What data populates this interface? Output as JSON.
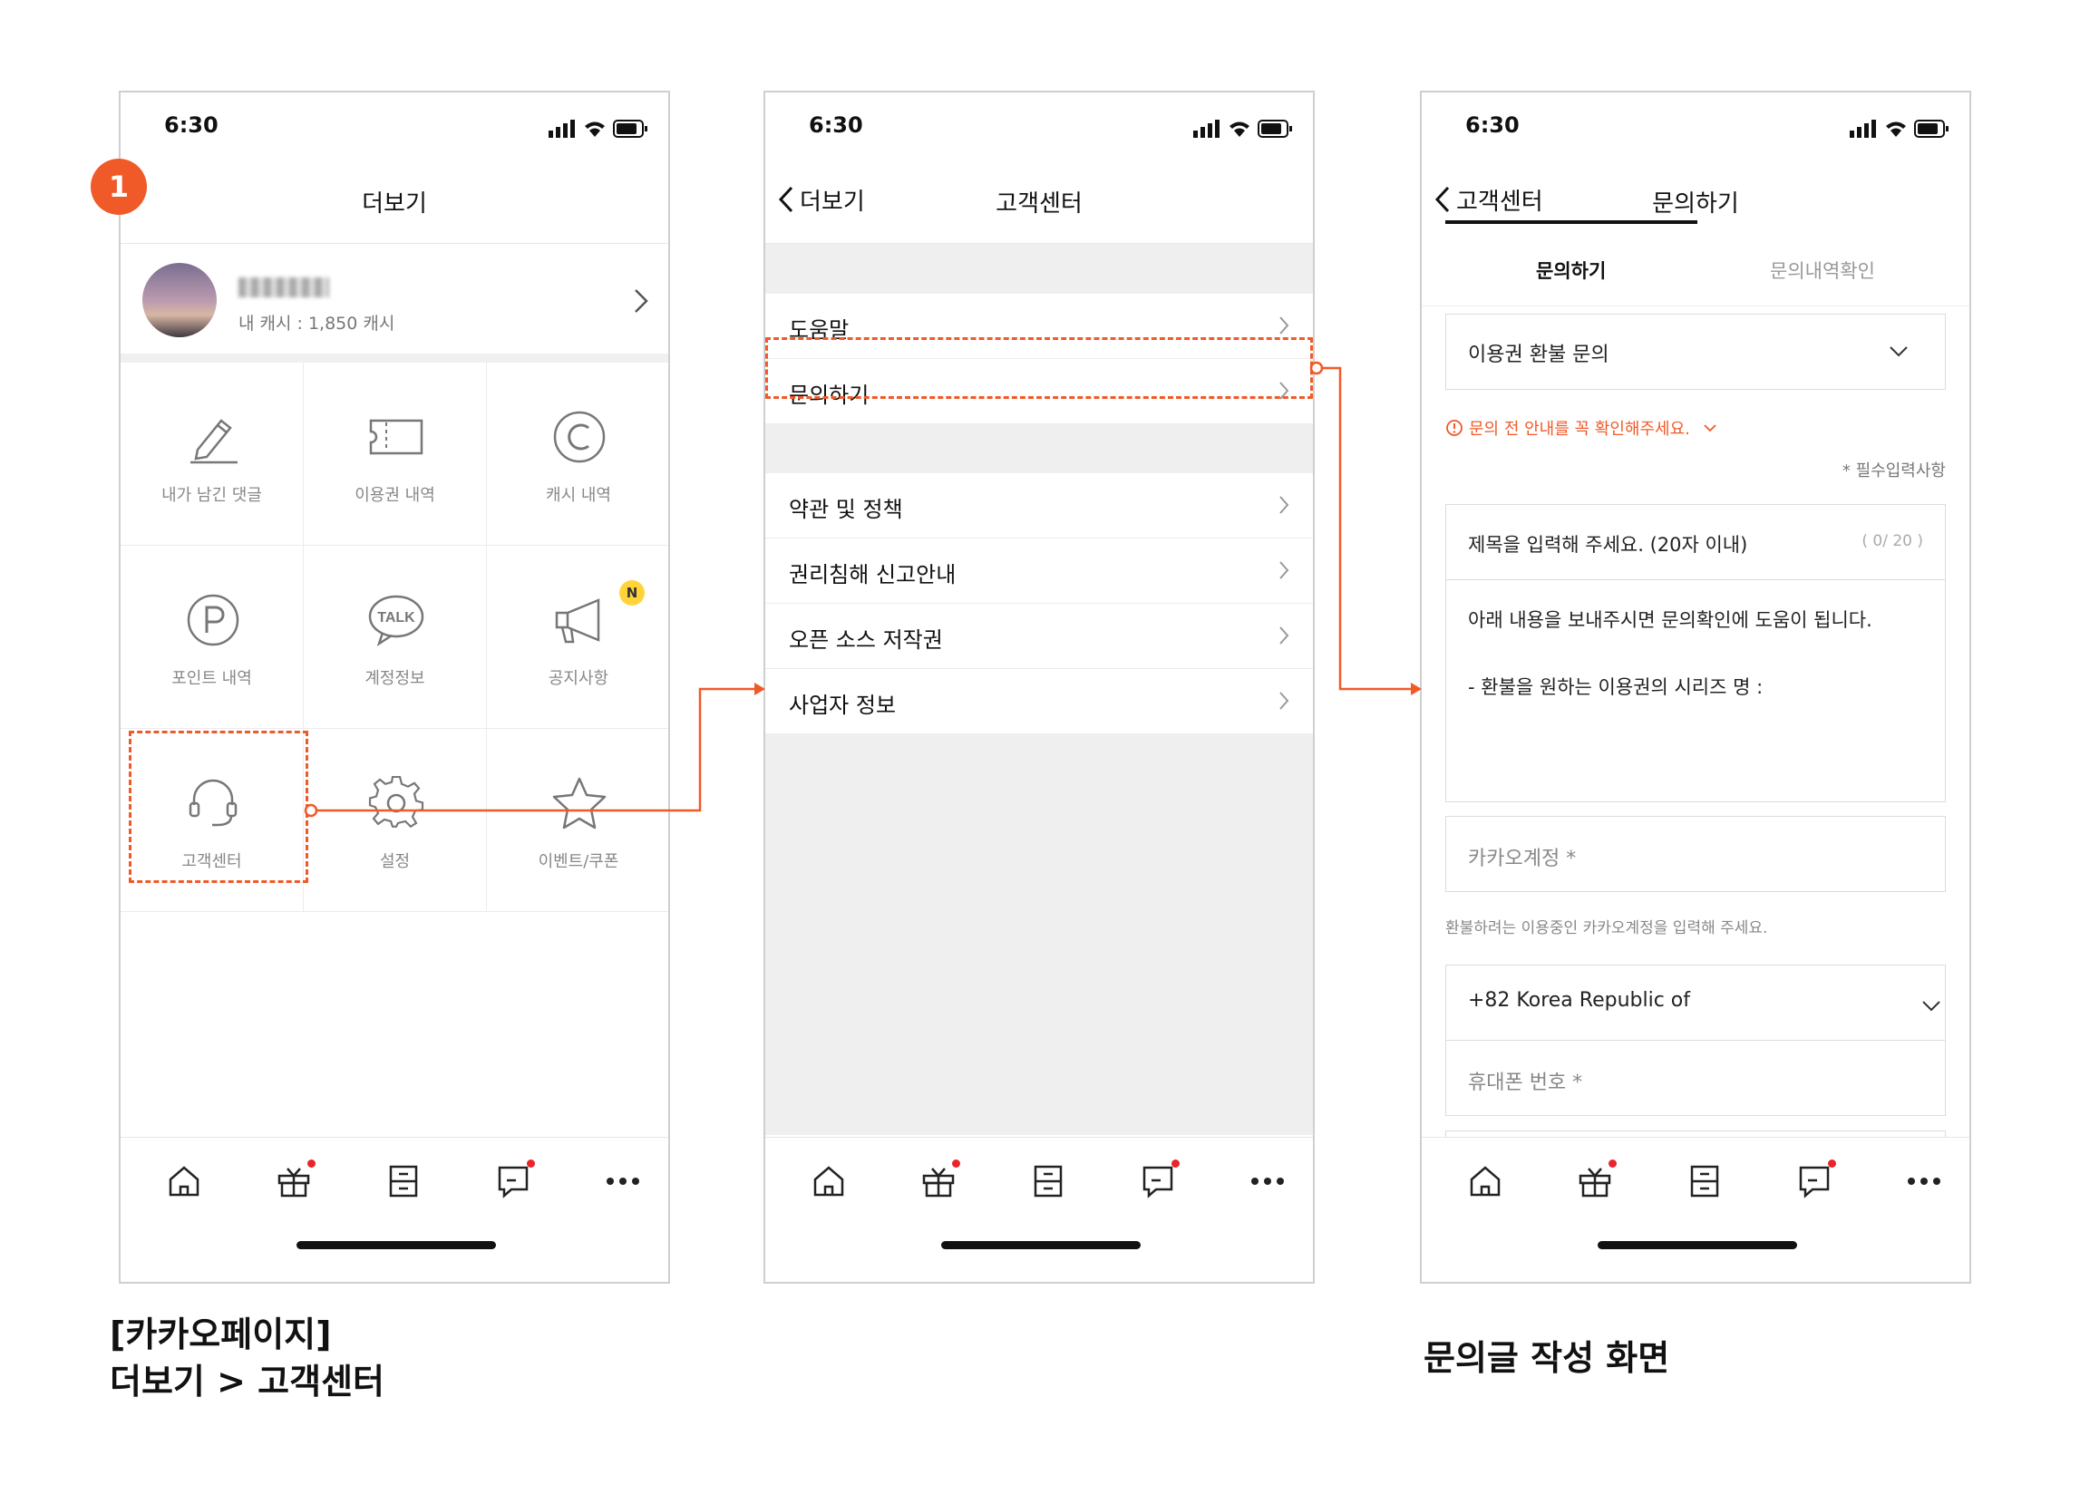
{
  "status_time": "6:30",
  "screen1": {
    "step_number": "1",
    "title": "더보기",
    "profile_cash": "내 캐시 : 1,850 캐시",
    "grid": [
      {
        "label": "내가 남긴 댓글",
        "icon": "pencil-icon"
      },
      {
        "label": "이용권 내역",
        "icon": "ticket-icon"
      },
      {
        "label": "캐시 내역",
        "icon": "cash-c-icon"
      },
      {
        "label": "포인트 내역",
        "icon": "point-p-icon"
      },
      {
        "label": "계정정보",
        "icon": "talk-bubble-icon"
      },
      {
        "label": "공지사항",
        "icon": "megaphone-icon",
        "badge": "N"
      },
      {
        "label": "고객센터",
        "icon": "headset-icon"
      },
      {
        "label": "설정",
        "icon": "gear-icon"
      },
      {
        "label": "이벤트/쿠폰",
        "icon": "star-icon"
      }
    ]
  },
  "screen2": {
    "back_label": "더보기",
    "title": "고객센터",
    "group1": [
      "도움말",
      "문의하기"
    ],
    "group2": [
      "약관 및 정책",
      "권리침해 신고안내",
      "오픈 소스 저작권",
      "사업자 정보"
    ]
  },
  "screen3": {
    "back_label": "고객센터",
    "title": "문의하기",
    "tab_active": "문의하기",
    "tab_inactive": "문의내역확인",
    "category_value": "이용권 환불 문의",
    "warning_text": "문의 전 안내를 꼭 확인해주세요.",
    "required_note": "* 필수입력사항",
    "subject_placeholder": "제목을 입력해 주세요. (20자 이내)",
    "subject_counter": "( 0/ 20 )",
    "body_line1": "아래 내용을 보내주시면 문의확인에 도움이 됩니다.",
    "body_line2": "- 환불을 원하는 이용권의 시리즈 명 :",
    "account_placeholder": "카카오계정 *",
    "account_helper": "환불하려는 이용중인 카카오계정을 입력해 주세요.",
    "country_value": "+82 Korea Republic of",
    "phone_placeholder": "휴대폰 번호 *"
  },
  "tabbar_icons": [
    "home-icon",
    "gift-icon",
    "library-icon",
    "chat-icon",
    "more-icon"
  ],
  "captions": {
    "left_line1": "[카카오페이지]",
    "left_line2": "더보기 > 고객센터",
    "right": "문의글 작성 화면"
  },
  "colors": {
    "accent": "#f05a28",
    "badge_yellow": "#ffd43b",
    "notif_red": "#e8252b"
  }
}
